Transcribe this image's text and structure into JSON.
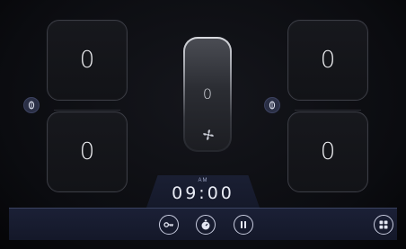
{
  "zones": {
    "left_top": "0",
    "left_bottom": "0",
    "right_top": "0",
    "right_bottom": "0"
  },
  "fan": {
    "value": "0",
    "icon": "fan-icon"
  },
  "sync_buttons": {
    "left_icon": "sync-icon",
    "right_icon": "sync-icon"
  },
  "clock": {
    "ampm": "AM",
    "time": "09:00"
  },
  "toolbar": {
    "key_icon": "key-icon",
    "timer_icon": "timer-icon",
    "pause_icon": "pause-icon",
    "apps_icon": "apps-grid-icon"
  },
  "colors": {
    "background": "#0b0c10",
    "bar": "#1b2036",
    "accent": "#3b4361"
  }
}
